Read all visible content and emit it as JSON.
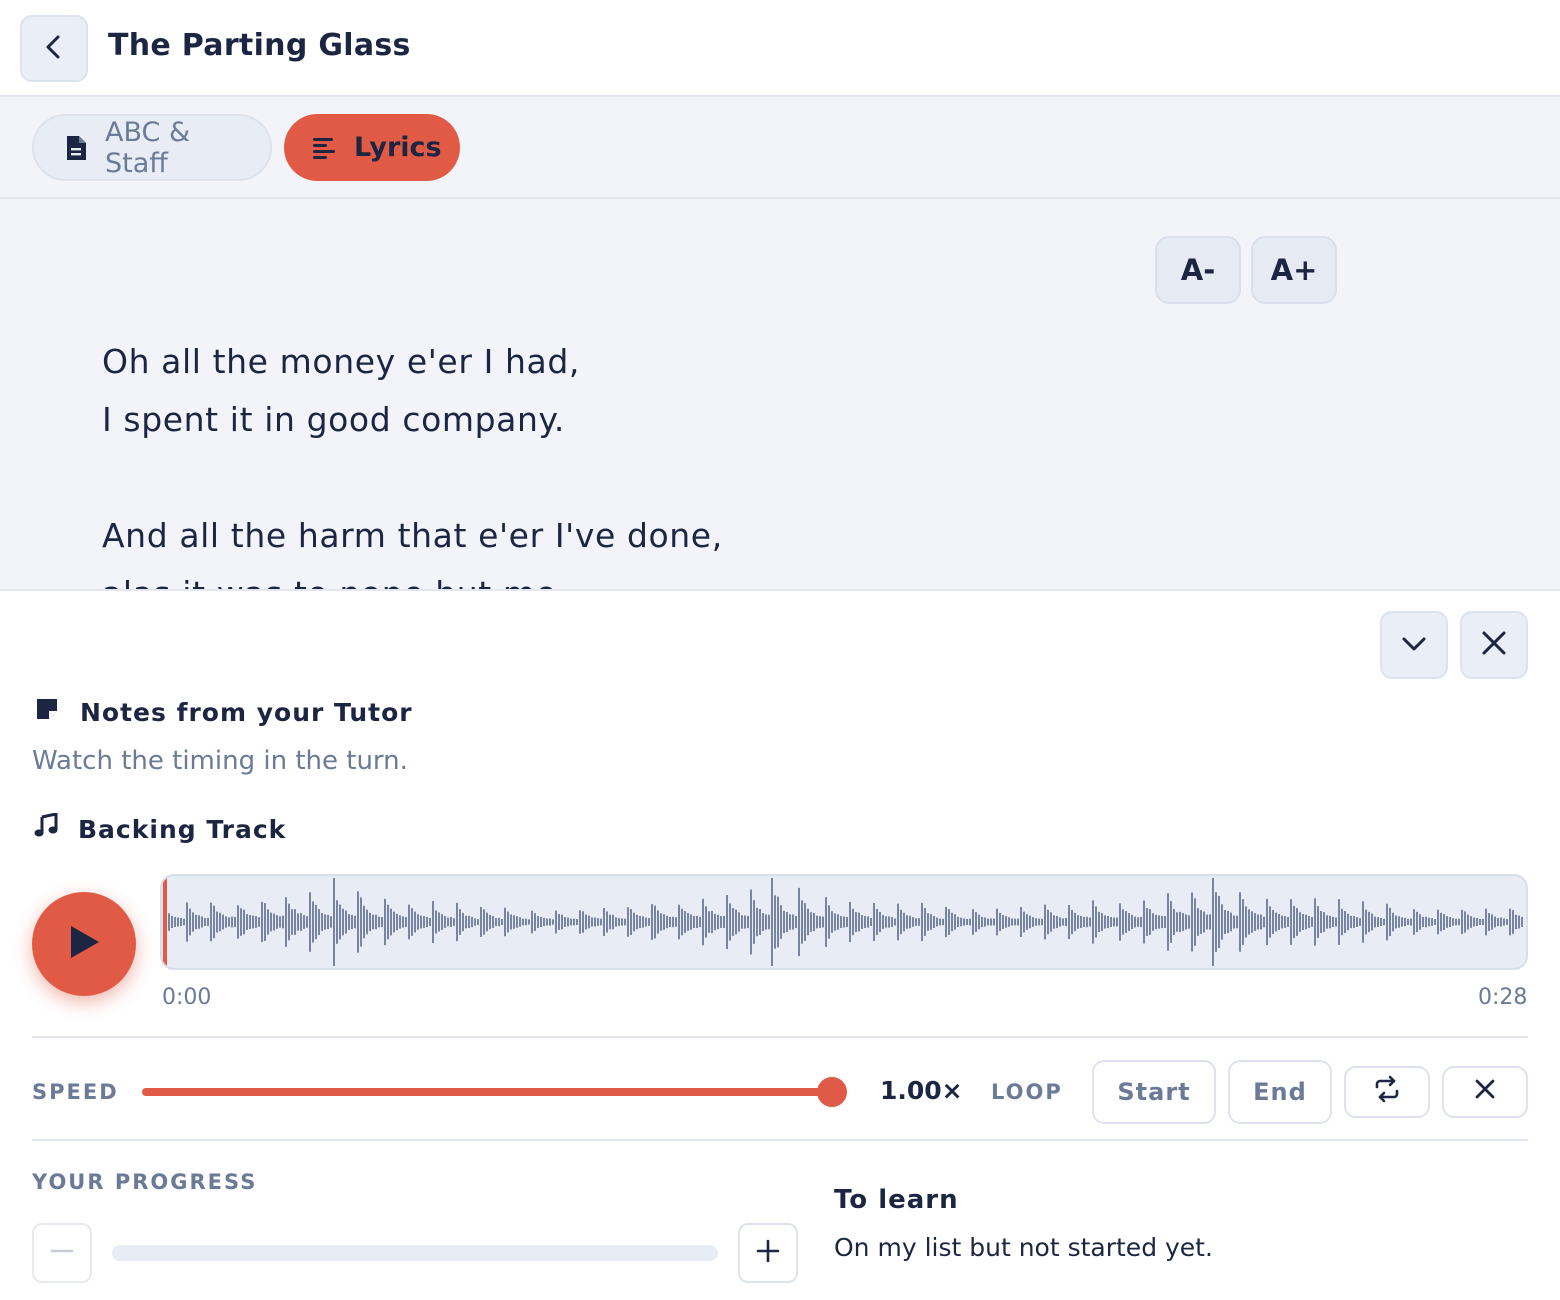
{
  "header": {
    "title": "The Parting Glass",
    "back_icon": "chevron-left-icon"
  },
  "tabs": [
    {
      "label": "ABC & Staff",
      "icon": "document-icon",
      "active": false
    },
    {
      "label": "Lyrics",
      "icon": "text-lines-icon",
      "active": true
    }
  ],
  "lyrics": {
    "font_decrease_label": "A-",
    "font_increase_label": "A+",
    "lines": [
      "Oh all the money e'er I had,",
      "I spent it in good company.",
      "",
      "And all the harm that e'er I've done,",
      "alas it was to none but me."
    ]
  },
  "panel": {
    "collapse_icon": "chevron-down-icon",
    "close_icon": "close-icon",
    "notes": {
      "heading": "Notes from your Tutor",
      "icon": "sticky-note-icon",
      "text": "Watch the timing in the turn."
    },
    "backing_track": {
      "heading": "Backing Track",
      "icon": "music-note-icon",
      "play_icon": "play-icon",
      "current_time": "0:00",
      "duration": "0:28",
      "playhead_fraction": 0
    },
    "controls": {
      "speed_label": "SPEED",
      "speed_value": "1.00×",
      "speed_fraction": 1.0,
      "loop_label": "LOOP",
      "loop_start_label": "Start",
      "loop_end_label": "End",
      "loop_toggle_icon": "repeat-icon",
      "loop_clear_icon": "close-icon"
    },
    "progress": {
      "label": "YOUR PROGRESS",
      "value_fraction": 0,
      "decrease_icon": "minus-icon",
      "increase_icon": "plus-icon",
      "status_title": "To learn",
      "status_description": "On my list but not started yet."
    }
  },
  "colors": {
    "accent": "#e05a45",
    "text_dark": "#1c2541",
    "text_muted": "#6b7a96",
    "surface_light": "#f2f4f9",
    "waveform": "#5d6b8c"
  }
}
